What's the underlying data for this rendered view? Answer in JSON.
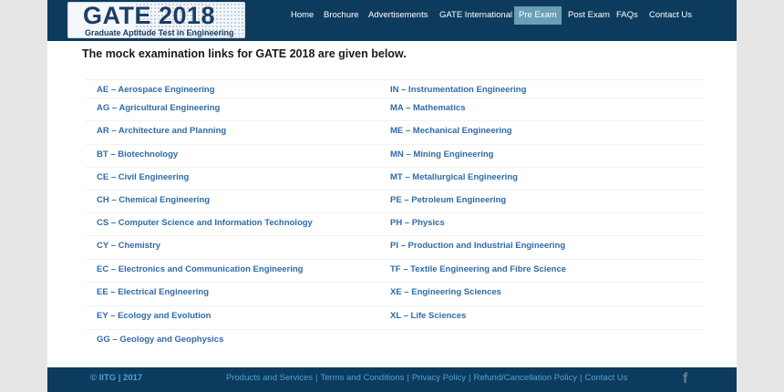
{
  "logo": {
    "title": "GATE 2018",
    "subtitle": "Graduate Aptitude Test in Engineering"
  },
  "nav": {
    "items": [
      {
        "label": "Home"
      },
      {
        "label": "Brochure"
      },
      {
        "label": "Advertisements"
      },
      {
        "label": "GATE International"
      },
      {
        "label": "Pre Exam"
      },
      {
        "label": "Post Exam"
      },
      {
        "label": "FAQs"
      },
      {
        "label": "Contact Us"
      }
    ],
    "active": "Pre Exam"
  },
  "main": {
    "heading": "The mock examination links for GATE 2018 are given below.",
    "left_links": [
      "AE – Aerospace Engineering",
      "AG – Agricultural Engineering",
      "AR – Architecture and Planning",
      "BT – Biotechnology",
      "CE – Civil Engineering",
      "CH – Chemical Engineering",
      "CS – Computer Science and Information Technology",
      "CY – Chemistry",
      "EC – Electronics and Communication Engineering",
      "EE – Electrical Engineering",
      "EY – Ecology and Evolution",
      "GG – Geology and Geophysics"
    ],
    "right_links": [
      "IN – Instrumentation Engineering",
      "MA – Mathematics",
      "ME – Mechanical Engineering",
      "MN – Mining Engineering",
      "MT – Metallurgical Engineering",
      "PE – Petroleum Engineering",
      "PH – Physics",
      "PI – Production and Industrial Engineering",
      "TF – Textile Engineering and Fibre Science",
      "XE – Engineering Sciences",
      "XL – Life Sciences"
    ]
  },
  "footer": {
    "copyright": "© IITG | 2017",
    "links": [
      "Products and Services",
      "Terms and Conditions",
      "Privacy Policy",
      "Refund/Cancellation Policy",
      "Contact Us"
    ],
    "separator": "|",
    "social_icon": "facebook-icon",
    "social_glyph": "f"
  },
  "colors": {
    "header_bg": "#0d3b5e",
    "active_nav_bg": "#6a9fb5",
    "link": "#2e6ba8",
    "footer_link": "#4aa3d6"
  }
}
